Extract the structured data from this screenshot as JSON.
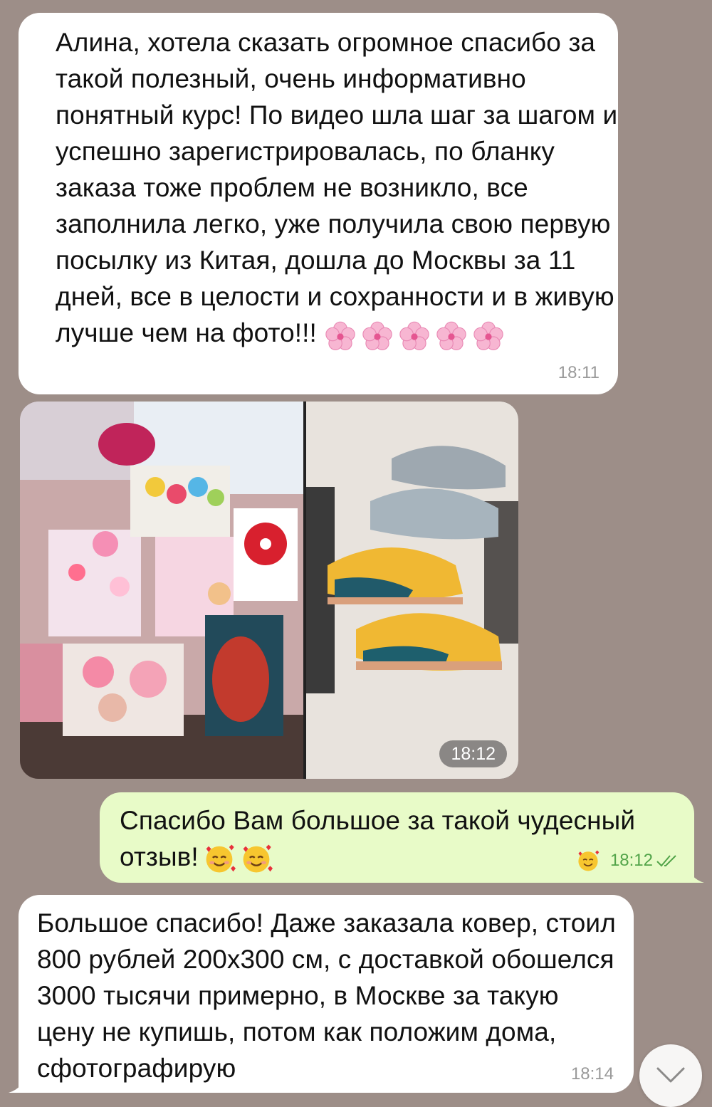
{
  "messages": [
    {
      "direction": "incoming",
      "text": "Алина, хотела сказать огромное спасибо за такой полезный, очень информативно понятный курс! По видео шла шаг за шагом и успешно зарегистрировалась, по бланку заказа тоже проблем не возникло, все заполнила легко, уже получила свою первую посылку из Китая, дошла до Москвы за 11 дней, все в целости и сохранности и в живую лучше чем на фото!!!",
      "emoji": "cherry-blossom x5",
      "time": "18:11"
    },
    {
      "direction": "incoming",
      "type": "photo-album",
      "photos": [
        "hair-accessories-photo",
        "sneakers-photo"
      ],
      "time": "18:12"
    },
    {
      "direction": "outgoing",
      "text": "Спасибо Вам большое за такой чудесный отзыв!",
      "emoji": "smiling-face-with-hearts x2",
      "reaction": "smiling-face-with-hearts",
      "time": "18:12",
      "status": "read"
    },
    {
      "direction": "incoming",
      "text": "Большое спасибо! Даже заказала ковер, стоил 800 рублей 200х300 см, с доставкой обошелся 3000 тысячи примерно, в Москве за такую цену не купишь, потом как положим дома, сфотографирую",
      "time": "18:14"
    }
  ],
  "colors": {
    "background": "#9d8e88",
    "incoming_bubble": "#ffffff",
    "outgoing_bubble": "#e8fbc8",
    "outgoing_time": "#52a449"
  },
  "scroll_button": {
    "icon": "chevron-down-icon"
  }
}
